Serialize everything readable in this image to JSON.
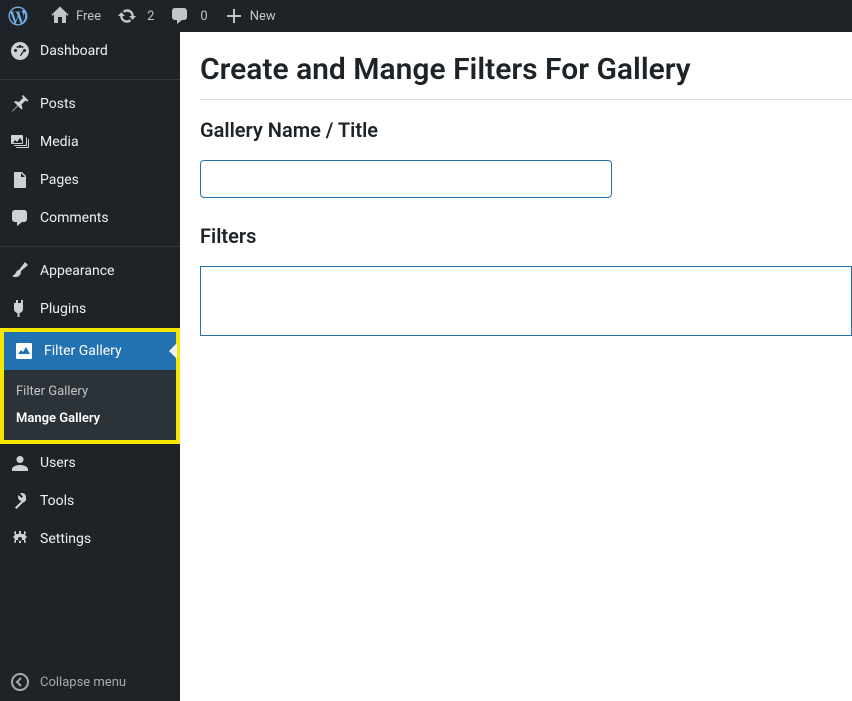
{
  "adminbar": {
    "site_name": "Free",
    "updates_count": "2",
    "comments_count": "0",
    "new_label": "New"
  },
  "sidebar": {
    "dashboard": "Dashboard",
    "posts": "Posts",
    "media": "Media",
    "pages": "Pages",
    "comments": "Comments",
    "appearance": "Appearance",
    "plugins": "Plugins",
    "filter_gallery": "Filter Gallery",
    "sub_filter_gallery": "Filter Gallery",
    "sub_mange_gallery": "Mange Gallery",
    "users": "Users",
    "tools": "Tools",
    "settings": "Settings",
    "collapse": "Collapse menu"
  },
  "main": {
    "title": "Create and Mange Filters For Gallery",
    "gallery_name_label": "Gallery Name / Title",
    "gallery_name_value": "",
    "filters_label": "Filters"
  }
}
